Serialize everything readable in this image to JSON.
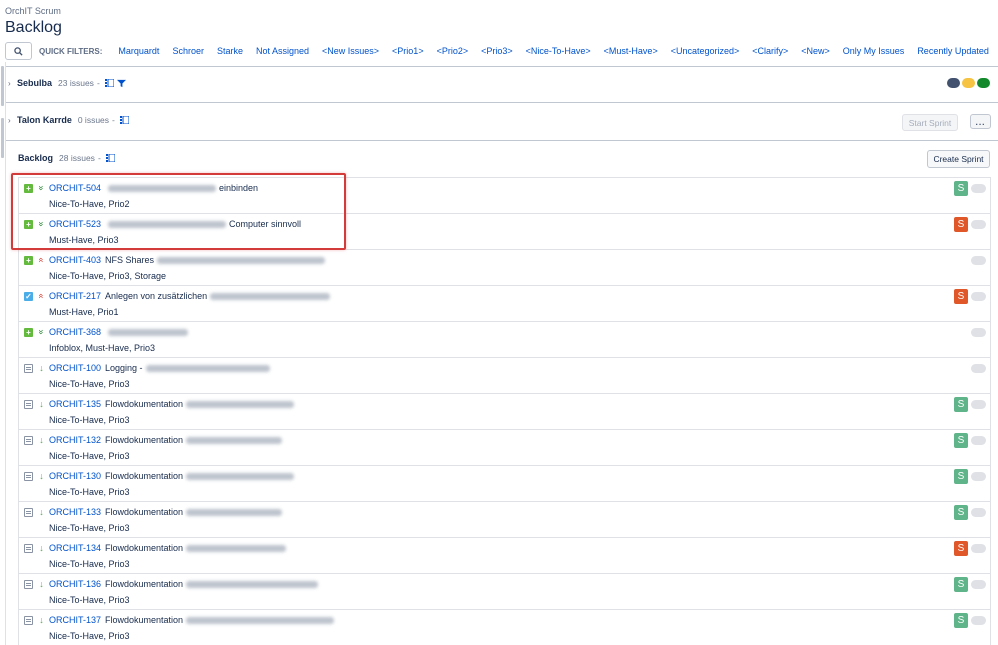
{
  "header": {
    "project_name": "OrchIT Scrum",
    "page_title": "Backlog"
  },
  "quick_filters": {
    "label": "QUICK FILTERS:",
    "items": [
      "Marquardt",
      "Schroer",
      "Starke",
      "Not Assigned",
      "<New Issues>",
      "<Prio1>",
      "<Prio2>",
      "<Prio3>",
      "<Nice-To-Have>",
      "<Must-Have>",
      "<Uncategorized>",
      "<Clarify>",
      "<New>",
      "Only My Issues",
      "Recently Updated"
    ]
  },
  "sprints": [
    {
      "name": "Sebulba",
      "count": "23 issues"
    },
    {
      "name": "Talon Karrde",
      "count": "0 issues"
    }
  ],
  "status_colors": [
    "#42526e",
    "#f6c342",
    "#14892c"
  ],
  "buttons": {
    "start_sprint": "Start Sprint",
    "more": "...",
    "create_sprint": "Create Sprint"
  },
  "backlog": {
    "name": "Backlog",
    "count": "28 issues",
    "issues": [
      {
        "key": "ORCHIT-504",
        "summary_pre": "",
        "summary_post": "einbinden",
        "labels": "Nice-To-Have, Prio2",
        "type": "story",
        "priority": "low",
        "assignee": "S",
        "assignee_color": "green"
      },
      {
        "key": "ORCHIT-523",
        "summary_pre": "",
        "summary_post": "Computer sinnvoll",
        "labels": "Must-Have, Prio3",
        "type": "story",
        "priority": "low",
        "assignee": "S",
        "assignee_color": "orange"
      },
      {
        "key": "ORCHIT-403",
        "summary_pre": "NFS Shares",
        "summary_post": "",
        "labels": "Nice-To-Have, Prio3, Storage",
        "type": "story",
        "priority": "high",
        "assignee": "",
        "assignee_color": ""
      },
      {
        "key": "ORCHIT-217",
        "summary_pre": "Anlegen von zusätzlichen",
        "summary_post": "",
        "labels": "Must-Have, Prio1",
        "type": "task",
        "priority": "high",
        "assignee": "S",
        "assignee_color": "orange"
      },
      {
        "key": "ORCHIT-368",
        "summary_pre": "",
        "summary_post": "",
        "labels": "Infoblox, Must-Have, Prio3",
        "type": "story",
        "priority": "low",
        "assignee": "",
        "assignee_color": ""
      },
      {
        "key": "ORCHIT-100",
        "summary_pre": "Logging -",
        "summary_post": "",
        "labels": "Nice-To-Have, Prio3",
        "type": "doc",
        "priority": "lowest",
        "assignee": "",
        "assignee_color": ""
      },
      {
        "key": "ORCHIT-135",
        "summary_pre": "Flowdokumentation",
        "summary_post": "",
        "labels": "Nice-To-Have, Prio3",
        "type": "doc",
        "priority": "lowest",
        "assignee": "S",
        "assignee_color": "green"
      },
      {
        "key": "ORCHIT-132",
        "summary_pre": "Flowdokumentation",
        "summary_post": "",
        "labels": "Nice-To-Have, Prio3",
        "type": "doc",
        "priority": "lowest",
        "assignee": "S",
        "assignee_color": "green"
      },
      {
        "key": "ORCHIT-130",
        "summary_pre": "Flowdokumentation",
        "summary_post": "",
        "labels": "Nice-To-Have, Prio3",
        "type": "doc",
        "priority": "lowest",
        "assignee": "S",
        "assignee_color": "green"
      },
      {
        "key": "ORCHIT-133",
        "summary_pre": "Flowdokumentation",
        "summary_post": "",
        "labels": "Nice-To-Have, Prio3",
        "type": "doc",
        "priority": "lowest",
        "assignee": "S",
        "assignee_color": "green"
      },
      {
        "key": "ORCHIT-134",
        "summary_pre": "Flowdokumentation",
        "summary_post": "",
        "labels": "Nice-To-Have, Prio3",
        "type": "doc",
        "priority": "lowest",
        "assignee": "S",
        "assignee_color": "orange"
      },
      {
        "key": "ORCHIT-136",
        "summary_pre": "Flowdokumentation",
        "summary_post": "",
        "labels": "Nice-To-Have, Prio3",
        "type": "doc",
        "priority": "lowest",
        "assignee": "S",
        "assignee_color": "green"
      },
      {
        "key": "ORCHIT-137",
        "summary_pre": "Flowdokumentation",
        "summary_post": "",
        "labels": "Nice-To-Have, Prio3",
        "type": "doc",
        "priority": "lowest",
        "assignee": "S",
        "assignee_color": "green"
      }
    ]
  }
}
